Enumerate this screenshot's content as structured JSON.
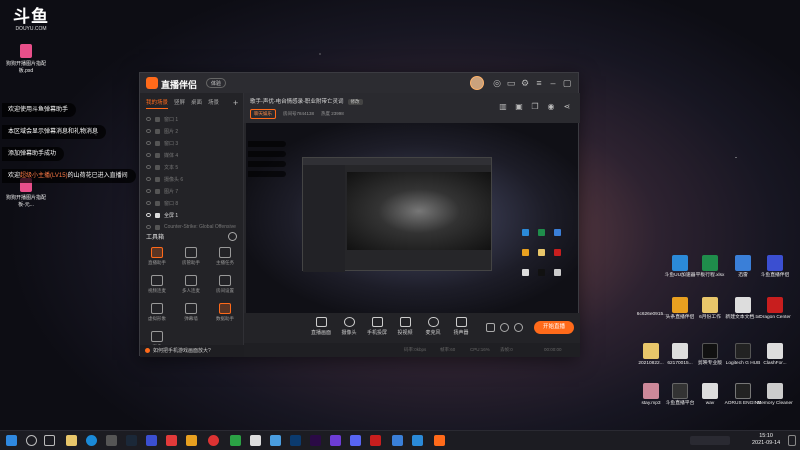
{
  "desktop": {
    "logo": {
      "mark": "斗鱼",
      "sub": "DOUYU.COM"
    },
    "left_files": [
      {
        "label": "狗狗开播图片指配板.psd"
      },
      {
        "label": "狗狗开播图片指配板-元..."
      }
    ],
    "chat_bubbles": [
      {
        "text": "欢迎使用斗鱼弹幕助手"
      },
      {
        "text": "本区域会显示弹幕消息和礼物消息"
      },
      {
        "text": "添加弹幕助手成功"
      },
      {
        "pre": "欢迎",
        "highlight": "超级小主播(LV15)",
        "post": "的山荷花已进入直播间"
      }
    ],
    "right_icons": [
      {
        "label": "斗鱼UU加速器",
        "color": "#2b8ad8"
      },
      {
        "label": "平板行程.xlsx",
        "color": "#1f8d4b"
      },
      {
        "label": "迅雷",
        "color": "#3a7fd8"
      },
      {
        "label": "斗鱼直播伴侣",
        "color": "#3b4fd1"
      },
      {
        "label": "头条直播伴侣",
        "color": "#e8a020"
      },
      {
        "label": "6月份工作",
        "color": "#e8c66a"
      },
      {
        "label": "新建文本文档.txt",
        "color": "#dddddd"
      },
      {
        "label": "Dragon Center",
        "color": "#c81e1e"
      },
      {
        "label": "20210822...",
        "color": "#e8c66a"
      },
      {
        "label": "62170015...",
        "color": "#dddddd"
      },
      {
        "label": "剪映专业版",
        "color": "#111111"
      },
      {
        "label": "Logitech G HUB",
        "color": "#222222"
      },
      {
        "label": "ClashFor...",
        "color": "#dddddd"
      },
      {
        "label": "stay.mp3",
        "color": "#cc8899"
      },
      {
        "label": "斗鱼直播平台",
        "color": "#333333"
      },
      {
        "label": "wav",
        "color": "#dddddd"
      },
      {
        "label": "AORUS ENGINE",
        "color": "#222222"
      },
      {
        "label": "Memory Cleaner",
        "color": "#cccccc"
      }
    ],
    "mid_label": "6c626e0915..."
  },
  "app": {
    "name": "直播伴侣",
    "version_badge": "体验",
    "tabs": [
      {
        "label": "我的场景",
        "active": true
      },
      {
        "label": "竖屏",
        "active": false
      },
      {
        "label": "桌面",
        "active": false
      },
      {
        "label": "场景",
        "active": false
      }
    ],
    "tab_add": "+",
    "scenes": [
      {
        "name": "窗口 1",
        "selected": false
      },
      {
        "name": "图片 2",
        "selected": false
      },
      {
        "name": "窗口 3",
        "selected": false
      },
      {
        "name": "媒体 4",
        "selected": false
      },
      {
        "name": "文本 5",
        "selected": false
      },
      {
        "name": "摄像头 6",
        "selected": false
      },
      {
        "name": "图片 7",
        "selected": false
      },
      {
        "name": "窗口 8",
        "selected": false
      },
      {
        "name": "全屏 1",
        "selected": true
      },
      {
        "name": "Counter-Strike: Global Offensive",
        "selected": false
      }
    ],
    "toolbox_title": "工具箱",
    "tools": [
      {
        "label": "直播助手",
        "orange": true
      },
      {
        "label": "房管助手",
        "orange": false
      },
      {
        "label": "主播任务",
        "orange": false
      },
      {
        "label": "视频连麦",
        "orange": false
      },
      {
        "label": "多人连麦",
        "orange": false
      },
      {
        "label": "房间设置",
        "orange": false
      },
      {
        "label": "虚拟形象",
        "orange": false
      },
      {
        "label": "弹幕墙",
        "orange": false
      },
      {
        "label": "数据助手",
        "orange": true
      },
      {
        "label": "更多",
        "orange": false
      },
      {
        "label": "开播设置",
        "orange": false
      },
      {
        "label": "特效",
        "orange": false
      }
    ],
    "notice": "如何把手机游戏画面放大?",
    "room": {
      "title": "歌手-声优-电台情感录-职业附带亡灵词",
      "edit": "修改",
      "category": "聊天娱乐",
      "id": "房间号7844138",
      "heat": "热度 23998"
    },
    "controls": [
      {
        "label": "直播画面"
      },
      {
        "label": "摄像头"
      },
      {
        "label": "手机投屏"
      },
      {
        "label": "投视频"
      },
      {
        "label": "麦克风"
      },
      {
        "label": "扬声器"
      }
    ],
    "go_live": "开始直播",
    "status": {
      "bitrate": "码率:0kbps",
      "fps": "帧率:60",
      "cpu": "CPU:16%",
      "drop": "丢帧:0",
      "time": "00:00:00"
    }
  },
  "taskbar": {
    "time": "15:10",
    "date": "2021-09-14"
  }
}
